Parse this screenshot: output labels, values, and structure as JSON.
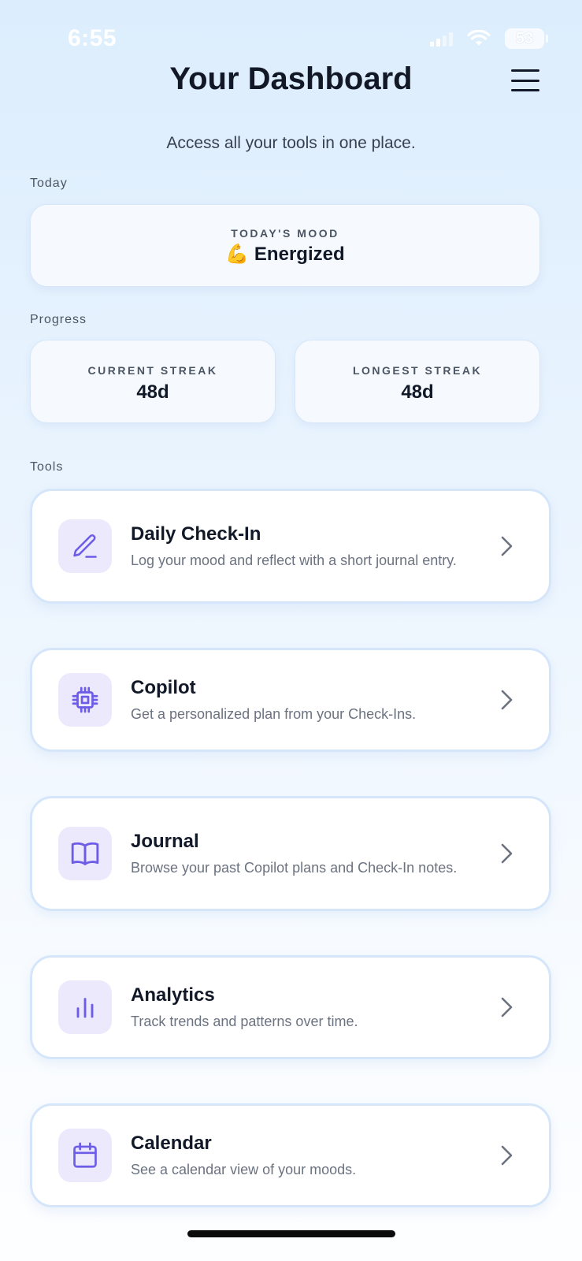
{
  "status_bar": {
    "time": "6:55",
    "battery": "53"
  },
  "header": {
    "title": "Your Dashboard",
    "subtitle": "Access all your tools in one place."
  },
  "sections": {
    "today": "Today",
    "progress": "Progress",
    "tools": "Tools"
  },
  "mood": {
    "label": "TODAY'S MOOD",
    "emoji": "💪",
    "value": "Energized"
  },
  "streaks": {
    "current": {
      "label": "CURRENT STREAK",
      "value": "48d"
    },
    "longest": {
      "label": "LONGEST STREAK",
      "value": "48d"
    }
  },
  "tools": [
    {
      "icon": "pencil-icon",
      "title": "Daily Check-In",
      "description": "Log your mood and reflect with a short journal entry."
    },
    {
      "icon": "cpu-chip-icon",
      "title": "Copilot",
      "description": "Get a personalized plan from your Check-Ins."
    },
    {
      "icon": "book-open-icon",
      "title": "Journal",
      "description": "Browse your past Copilot plans and Check-In notes."
    },
    {
      "icon": "bar-chart-icon",
      "title": "Analytics",
      "description": "Track trends and patterns over time."
    },
    {
      "icon": "calendar-icon",
      "title": "Calendar",
      "description": "See a calendar view of your moods."
    }
  ],
  "colors": {
    "accent": "#6c5ce7",
    "icon_bg": "#ece9fd",
    "card_border": "#d6e6fa"
  }
}
